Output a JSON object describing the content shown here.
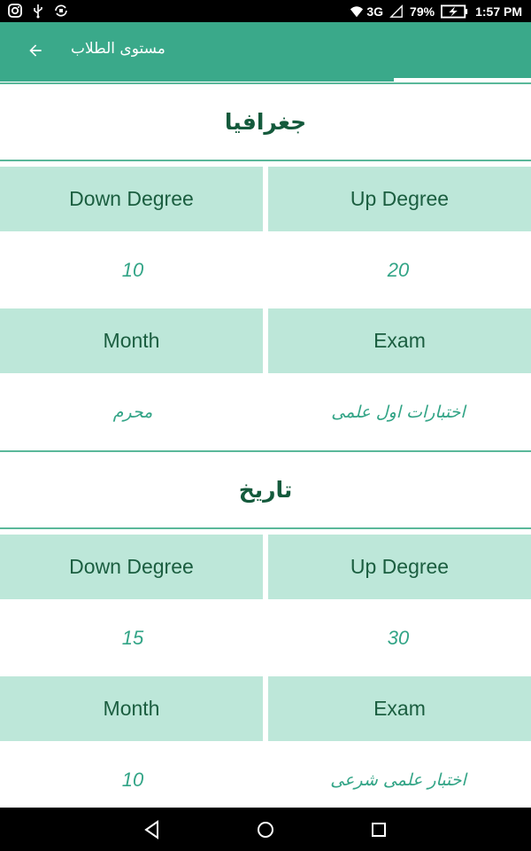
{
  "status_bar": {
    "network": "3G",
    "battery": "79%",
    "time": "1:57 PM",
    "icons": [
      "instagram-icon",
      "usb-icon",
      "sync-icon",
      "wifi-icon",
      "signal-icon",
      "battery-charging-icon"
    ]
  },
  "app_bar": {
    "title": "مستوى الطلاب",
    "back_icon": "arrow-back-icon",
    "color": "#3aa98a"
  },
  "subjects": [
    {
      "name": "جغرافيا",
      "headers": {
        "down": "Down Degree",
        "up": "Up Degree",
        "month": "Month",
        "exam": "Exam"
      },
      "down_degree": "10",
      "up_degree": "20",
      "month": "محرم",
      "exam": "اختبارات اول علمى"
    },
    {
      "name": "تاريخ",
      "headers": {
        "down": "Down Degree",
        "up": "Up Degree",
        "month": "Month",
        "exam": "Exam"
      },
      "down_degree": "15",
      "up_degree": "30",
      "month": "10",
      "exam": "اختبار علمى شرعى"
    }
  ],
  "nav_bar": {
    "icons": [
      "back-triangle-icon",
      "home-circle-icon",
      "recents-square-icon"
    ]
  },
  "colors": {
    "accent": "#3aa98a",
    "header_cell": "#bde7d9",
    "title_text": "#145a3c",
    "value_text": "#32a486"
  }
}
